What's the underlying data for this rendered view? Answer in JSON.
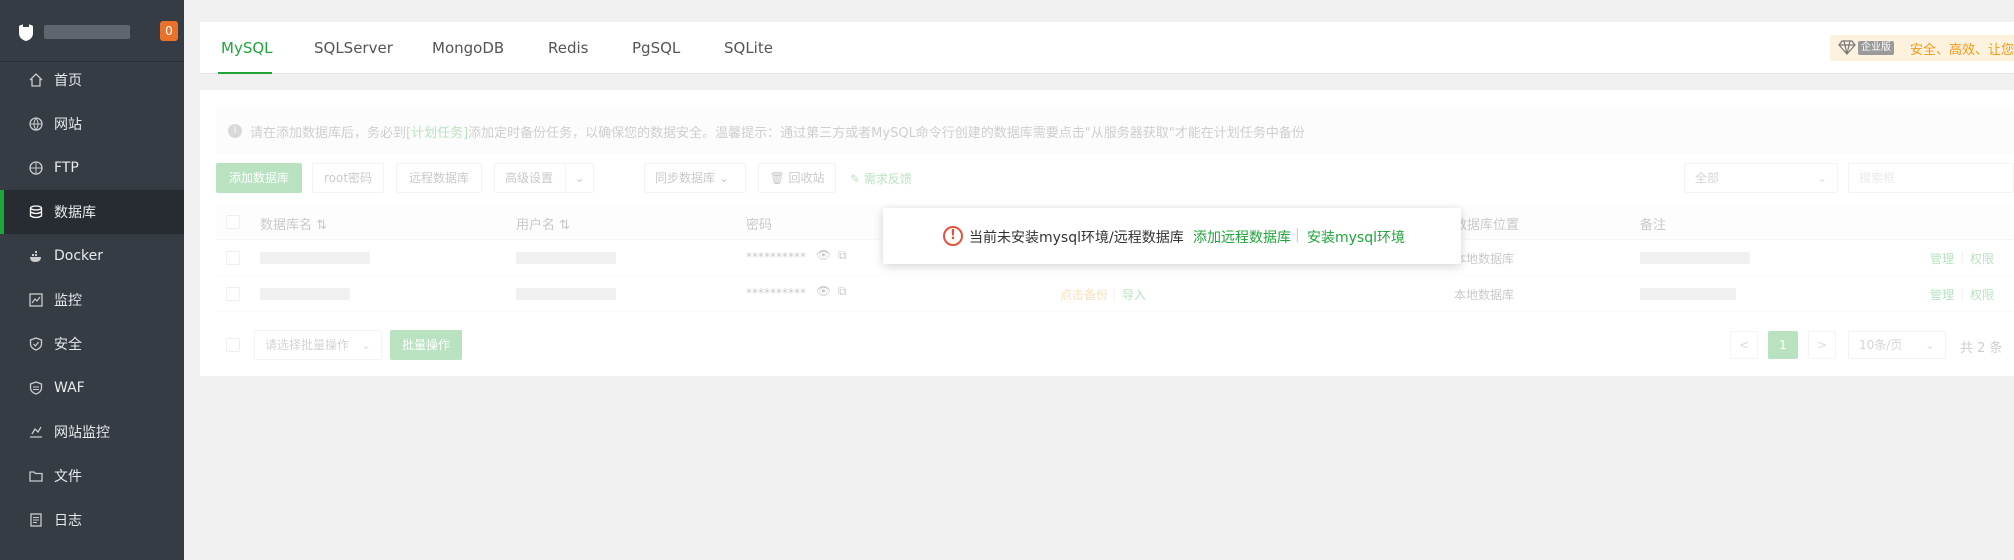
{
  "sidebar": {
    "badge": "0",
    "items": [
      {
        "label": "首页",
        "icon": "home-icon"
      },
      {
        "label": "网站",
        "icon": "globe-icon"
      },
      {
        "label": "FTP",
        "icon": "ftp-icon"
      },
      {
        "label": "数据库",
        "icon": "database-icon",
        "active": true
      },
      {
        "label": "Docker",
        "icon": "docker-icon"
      },
      {
        "label": "监控",
        "icon": "monitor-icon"
      },
      {
        "label": "安全",
        "icon": "shield-icon"
      },
      {
        "label": "WAF",
        "icon": "waf-icon"
      },
      {
        "label": "网站监控",
        "icon": "site-monitor-icon"
      },
      {
        "label": "文件",
        "icon": "folder-icon"
      },
      {
        "label": "日志",
        "icon": "log-icon"
      }
    ]
  },
  "tabs": [
    "MySQL",
    "SQLServer",
    "MongoDB",
    "Redis",
    "PgSQL",
    "SQLite"
  ],
  "active_tab": "MySQL",
  "enterprise": {
    "tag": "企业版",
    "text": "安全、高效、让您更"
  },
  "tip": {
    "prefix": "请在添加数据库后，务必到",
    "link": "[计划任务]",
    "suffix": "添加定时备份任务，以确保您的数据安全。温馨提示：通过第三方或者MySQL命令行创建的数据库需要点击\"从服务器获取\"才能在计划任务中备份"
  },
  "toolbar": {
    "add_db": "添加数据库",
    "root_pwd": "root密码",
    "remote_db": "远程数据库",
    "advanced": "高级设置",
    "sync_db": "同步数据库",
    "recycle": "回收站",
    "feedback": "需求反馈",
    "filter_all": "全部",
    "search_placeholder": "搜索框"
  },
  "table": {
    "headers": [
      "数据库名",
      "用户名",
      "密码",
      "数据库位置",
      "备注"
    ],
    "rows": [
      {
        "password": "**********",
        "location": "本地数据库",
        "ops": [
          "管理",
          "权限"
        ],
        "backup": "",
        "import": ""
      },
      {
        "password": "**********",
        "location": "本地数据库",
        "ops": [
          "管理",
          "权限"
        ],
        "backup": "点击备份",
        "import": "导入"
      }
    ]
  },
  "footer": {
    "batch_select": "请选择批量操作",
    "batch_btn": "批量操作",
    "prev": "<",
    "page": "1",
    "next": ">",
    "per_page": "10条/页",
    "total": "共 2 条"
  },
  "popup": {
    "icon": "!",
    "message": "当前未安装mysql环境/远程数据库",
    "link_add_remote": "添加远程数据库",
    "separator": "|",
    "link_install": "安装mysql环境"
  },
  "colors": {
    "accent": "#20a53a",
    "sidebar_bg": "#353c44",
    "badge": "#e8722a",
    "warning": "#e0533c"
  }
}
